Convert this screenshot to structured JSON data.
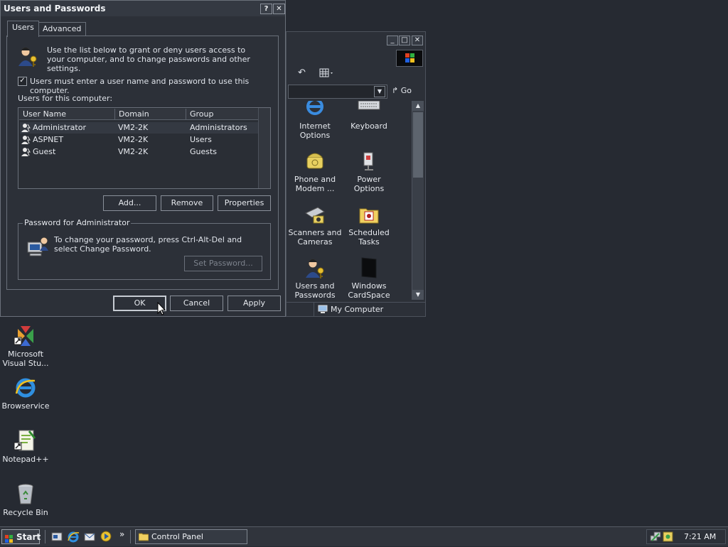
{
  "dialog": {
    "title": "Users and Passwords",
    "help_btn": "?",
    "close_btn": "✕",
    "tabs": [
      {
        "label": "Users"
      },
      {
        "label": "Advanced"
      }
    ],
    "intro_text": "Use the list below to grant or deny users access to your computer, and to change passwords and other settings.",
    "checkbox_label": "Users must enter a user name and password to use this computer.",
    "checkbox_checked": true,
    "users_label": "Users for this computer:",
    "columns": [
      "User Name",
      "Domain",
      "Group"
    ],
    "users": [
      {
        "name": "Administrator",
        "domain": "VM2-2K",
        "group": "Administrators"
      },
      {
        "name": "ASPNET",
        "domain": "VM2-2K",
        "group": "Users"
      },
      {
        "name": "Guest",
        "domain": "VM2-2K",
        "group": "Guests"
      }
    ],
    "buttons": {
      "add": "Add...",
      "remove": "Remove",
      "properties": "Properties"
    },
    "password_group": {
      "legend": "Password for Administrator",
      "text": "To change your password, press Ctrl-Alt-Del and select Change Password.",
      "set_password": "Set Password..."
    },
    "footer": {
      "ok": "OK",
      "cancel": "Cancel",
      "apply": "Apply"
    }
  },
  "control_panel": {
    "go_label": "Go",
    "items": [
      {
        "label": "Internet Options",
        "icon": "internet-options-icon"
      },
      {
        "label": "Keyboard",
        "icon": "keyboard-icon"
      },
      {
        "label": "Phone and Modem ...",
        "icon": "phone-modem-icon"
      },
      {
        "label": "Power Options",
        "icon": "power-options-icon"
      },
      {
        "label": "Scanners and Cameras",
        "icon": "scanner-icon"
      },
      {
        "label": "Scheduled Tasks",
        "icon": "scheduled-tasks-icon"
      },
      {
        "label": "Users and Passwords",
        "icon": "users-icon"
      },
      {
        "label": "Windows CardSpace",
        "icon": "cardspace-icon"
      }
    ],
    "status_label": "My Computer"
  },
  "desktop": {
    "icons": [
      {
        "label": "Microsoft Visual Stu...",
        "icon": "visual-studio-icon"
      },
      {
        "label": "Browservice",
        "icon": "internet-explorer-icon"
      },
      {
        "label": "Notepad++",
        "icon": "notepad-plus-icon"
      },
      {
        "label": "Recycle Bin",
        "icon": "recycle-bin-icon"
      }
    ]
  },
  "taskbar": {
    "start_label": "Start",
    "quicklaunch_more": "»",
    "task_label": "Control Panel",
    "clock": "7:21 AM"
  }
}
